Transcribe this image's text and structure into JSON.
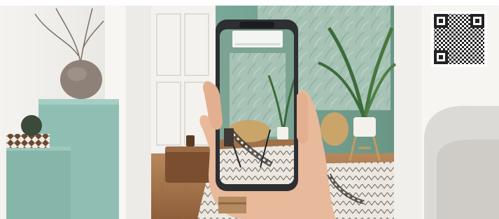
{
  "scene": {
    "colors": {
      "wall_left": "#efeeeb",
      "pedestal": "#8fbfb3",
      "pedestal_shade": "#7aab9e",
      "doorway_wall": "#6f9d8c",
      "door": "#f2f1ee",
      "floor": "#a0714a",
      "rug": "#e8e4dc",
      "phone_frame": "#2d2f33",
      "skin": "#e8b99a",
      "sofa": "#d9d7d3"
    },
    "icons": [
      "qr-code-icon"
    ]
  }
}
